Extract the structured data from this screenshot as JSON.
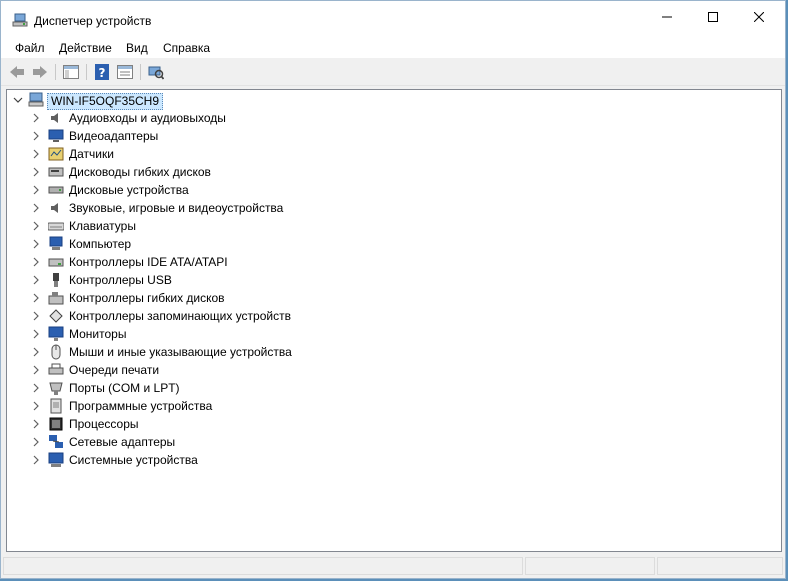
{
  "window": {
    "title": "Диспетчер устройств"
  },
  "menubar": {
    "items": [
      "Файл",
      "Действие",
      "Вид",
      "Справка"
    ]
  },
  "tree": {
    "root": "WIN-IF5OQF35CH9",
    "categories": [
      "Аудиовходы и аудиовыходы",
      "Видеоадаптеры",
      "Датчики",
      "Дисководы гибких дисков",
      "Дисковые устройства",
      "Звуковые, игровые и видеоустройства",
      "Клавиатуры",
      "Компьютер",
      "Контроллеры IDE ATA/ATAPI",
      "Контроллеры USB",
      "Контроллеры гибких дисков",
      "Контроллеры запоминающих устройств",
      "Мониторы",
      "Мыши и иные указывающие устройства",
      "Очереди печати",
      "Порты (COM и LPT)",
      "Программные устройства",
      "Процессоры",
      "Сетевые адаптеры",
      "Системные устройства"
    ]
  }
}
